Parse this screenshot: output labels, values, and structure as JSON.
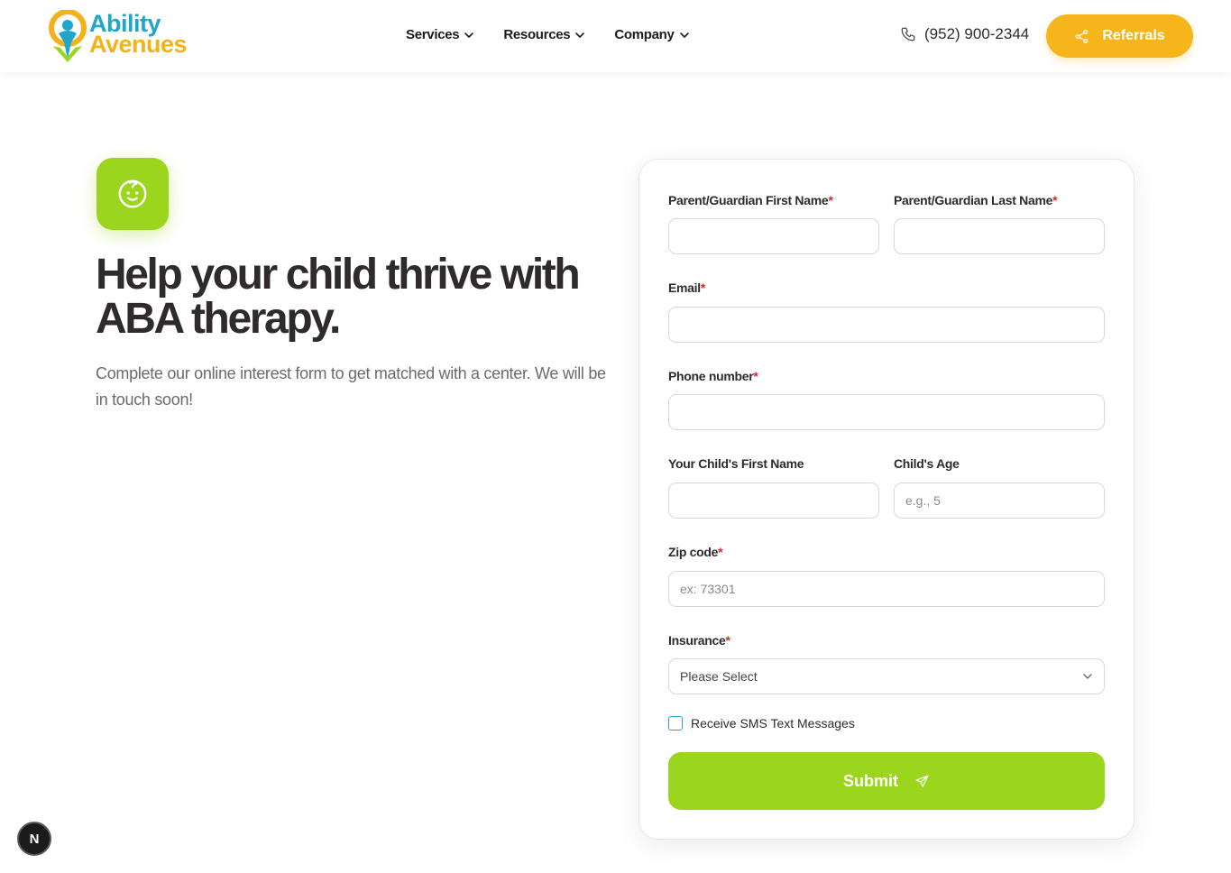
{
  "brand": {
    "line1": "Ability",
    "line2": "Avenues"
  },
  "nav": [
    {
      "label": "Services"
    },
    {
      "label": "Resources"
    },
    {
      "label": "Company"
    }
  ],
  "header": {
    "phone": "(952) 900-2344",
    "referrals_label": "Referrals"
  },
  "hero": {
    "title": "Help your child thrive with ABA therapy.",
    "subtitle": "Complete our online interest form to get matched with a center. We will be in touch soon!"
  },
  "form": {
    "first_name_label": "Parent/Guardian First Name",
    "last_name_label": "Parent/Guardian Last Name",
    "email_label": "Email",
    "phone_label": "Phone number",
    "child_first_name_label": "Your Child's First Name",
    "child_age_label": "Child's Age",
    "child_age_placeholder": "e.g., 5",
    "zip_label": "Zip code",
    "zip_placeholder": "ex: 73301",
    "insurance_label": "Insurance",
    "insurance_value": "Please Select",
    "sms_label": "Receive SMS Text Messages",
    "submit_label": "Submit",
    "required_mark": "*"
  },
  "badge": {
    "letter": "N"
  },
  "colors": {
    "brand_blue": "#1fa7c9",
    "brand_yellow": "#f6b61b",
    "brand_green": "#9bd51d",
    "required": "#e0242f"
  }
}
